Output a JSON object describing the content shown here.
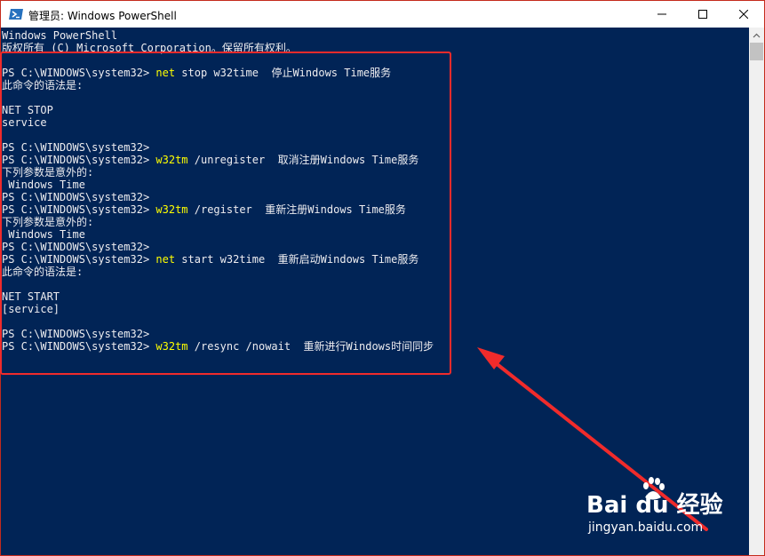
{
  "window": {
    "title": "管理员: Windows PowerShell",
    "icon": "powershell-icon",
    "controls": {
      "minimize": "minimize-icon",
      "maximize": "maximize-icon",
      "close": "close-icon"
    }
  },
  "console": {
    "lines": [
      {
        "text": "Windows PowerShell"
      },
      {
        "text": "版权所有 (C) Microsoft Corporation。保留所有权利。"
      },
      {
        "text": ""
      },
      {
        "prompt": "PS C:\\WINDOWS\\system32> ",
        "cmd": "net",
        "rest": " stop w32time  停止Windows Time服务"
      },
      {
        "text": "此命令的语法是:"
      },
      {
        "text": ""
      },
      {
        "text": "NET STOP"
      },
      {
        "text": "service"
      },
      {
        "text": ""
      },
      {
        "text": "PS C:\\WINDOWS\\system32>"
      },
      {
        "prompt": "PS C:\\WINDOWS\\system32> ",
        "cmd": "w32tm",
        "rest": " /unregister  取消注册Windows Time服务"
      },
      {
        "text": "下列参数是意外的:"
      },
      {
        "text": " Windows Time"
      },
      {
        "text": "PS C:\\WINDOWS\\system32>"
      },
      {
        "prompt": "PS C:\\WINDOWS\\system32> ",
        "cmd": "w32tm",
        "rest": " /register  重新注册Windows Time服务"
      },
      {
        "text": "下列参数是意外的:"
      },
      {
        "text": " Windows Time"
      },
      {
        "text": "PS C:\\WINDOWS\\system32>"
      },
      {
        "prompt": "PS C:\\WINDOWS\\system32> ",
        "cmd": "net",
        "rest": " start w32time  重新启动Windows Time服务"
      },
      {
        "text": "此命令的语法是:"
      },
      {
        "text": ""
      },
      {
        "text": "NET START"
      },
      {
        "text": "[service]"
      },
      {
        "text": ""
      },
      {
        "text": "PS C:\\WINDOWS\\system32>"
      },
      {
        "prompt": "PS C:\\WINDOWS\\system32> ",
        "cmd": "w32tm",
        "rest": " /resync /nowait  重新进行Windows时间同步"
      }
    ],
    "colors": {
      "background": "#012456",
      "text": "#eeedf0",
      "command": "#ffff00"
    }
  },
  "annotation": {
    "highlight_color": "#f02b2b",
    "arrow_color": "#f02b2b"
  },
  "watermark": {
    "main": "Bai  du 经验",
    "sub": "jingyan.baidu.com"
  }
}
